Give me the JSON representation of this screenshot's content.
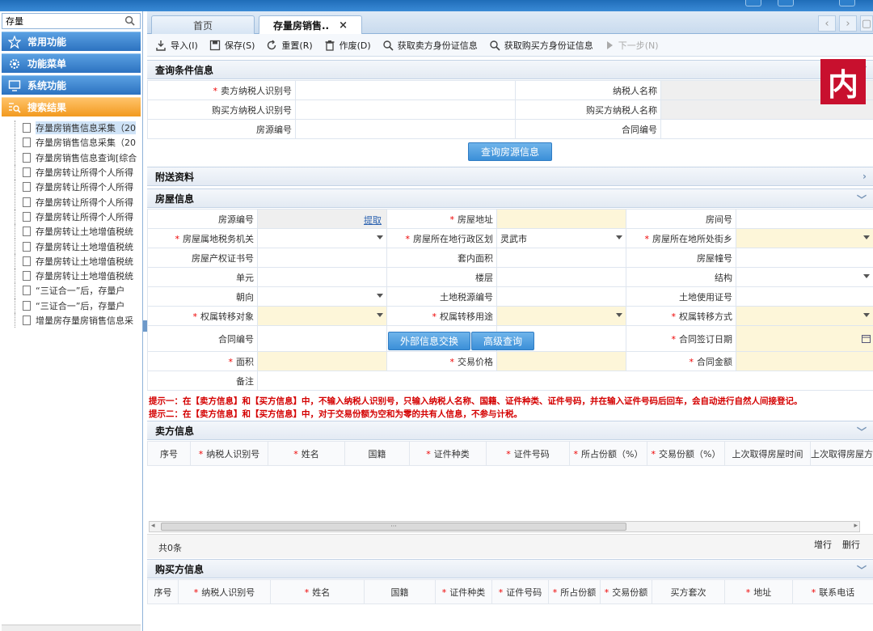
{
  "sidebar": {
    "search": {
      "value": "存量"
    },
    "nav": [
      "常用功能",
      "功能菜单",
      "系统功能",
      "搜索结果"
    ],
    "tree": [
      "存量房销售信息采集（20",
      "存量房销售信息采集（20",
      "存量房销售信息查询[综合",
      "存量房转让所得个人所得",
      "存量房转让所得个人所得",
      "存量房转让所得个人所得",
      "存量房转让所得个人所得",
      "存量房转让土地增值税统",
      "存量房转让土地增值税统",
      "存量房转让土地增值税统",
      "存量房转让土地增值税统",
      "“三证合一”后，存量户",
      "“三证合一”后，存量户",
      "增量房存量房销售信息采"
    ]
  },
  "tabs": {
    "home": "首页",
    "active": "存量房销售..",
    "close": "×"
  },
  "toolbar": [
    "导入(I)",
    "保存(S)",
    "重置(R)",
    "作废(D)",
    "获取卖方身份证信息",
    "获取购买方身份证信息",
    "下一步(N)"
  ],
  "query": {
    "title": "查询条件信息",
    "seller_id": "卖方纳税人识别号",
    "taxpayer_name": "纳税人名称",
    "buyer_id": "购买方纳税人识别号",
    "buyer_name": "购买方纳税人名称",
    "house_no": "房源编号",
    "contract_no": "合同编号",
    "button": "查询房源信息"
  },
  "attach": {
    "title": "附送资料"
  },
  "house": {
    "title": "房屋信息",
    "house_no": "房源编号",
    "fetch": "提取",
    "address": "房屋地址",
    "room_no": "房间号",
    "tax_office": "房屋属地税务机关",
    "district": "房屋所在地行政区划",
    "district_value": "灵武市",
    "street": "房屋所在地所处街乡",
    "cert_no": "房屋产权证书号",
    "inner_area": "套内面积",
    "building_no": "房屋幢号",
    "unit": "单元",
    "floor": "楼层",
    "structure": "结构",
    "orientation": "朝向",
    "land_tax_no": "土地税源编号",
    "land_cert": "土地使用证号",
    "transfer_obj": "权属转移对象",
    "transfer_use": "权属转移用途",
    "transfer_way": "权属转移方式",
    "contract_no": "合同编号",
    "btn_exchange": "外部信息交换",
    "btn_advanced": "高级查询",
    "sign_date": "合同签订日期",
    "area": "面积",
    "price": "交易价格",
    "amount": "合同金额",
    "remark": "备注"
  },
  "hints": [
    "提示一：在【卖方信息】和【买方信息】中，不输入纳税人识别号，只输入纳税人名称、国籍、证件种类、证件号码，并在输入证件号码后回车，会自动进行自然人间接登记。",
    "提示二：在【卖方信息】和【买方信息】中，对于交易份额为空和为零的共有人信息，不参与计税。"
  ],
  "seller": {
    "title": "卖方信息",
    "columns": [
      "序号",
      "纳税人识别号",
      "姓名",
      "国籍",
      "证件种类",
      "证件号码",
      "所占份额（%）",
      "交易份额（%）",
      "上次取得房屋时间",
      "上次取得房屋方"
    ],
    "count": "共0条",
    "add": "增行",
    "del": "删行"
  },
  "buyer": {
    "title": "购买方信息",
    "columns": [
      "序号",
      "纳税人识别号",
      "姓名",
      "国籍",
      "证件种类",
      "证件号码",
      "所占份额",
      "交易份额",
      "买方套次",
      "地址",
      "联系电话"
    ]
  },
  "badge": "内",
  "colors": {
    "accent": "#2c72c0",
    "active_nav": "#f29a1f",
    "required": "#e00000",
    "hint": "#d40000"
  }
}
